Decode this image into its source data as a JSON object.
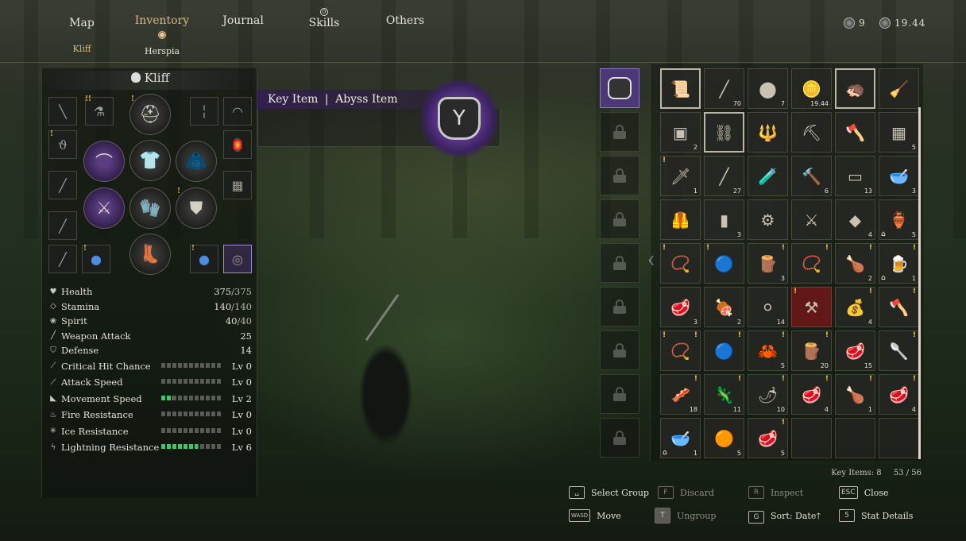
{
  "nav": {
    "tabs": [
      "Map",
      "Inventory",
      "Journal",
      "Skills",
      "Others"
    ],
    "skills_badge": "0",
    "subtabs": [
      "Kliff",
      "Herspia"
    ]
  },
  "currency": {
    "medals": "9",
    "coins": "19.44"
  },
  "character": {
    "name": "Kliff",
    "stats": [
      {
        "icon": "heart-icon",
        "label": "Health",
        "value": "375",
        "max": "/375"
      },
      {
        "icon": "stamina-icon",
        "label": "Stamina",
        "value": "140",
        "max": "/140"
      },
      {
        "icon": "spirit-icon",
        "label": "Spirit",
        "value": "40",
        "max": "/40"
      },
      {
        "icon": "sword-icon",
        "label": "Weapon Attack",
        "value": "25",
        "max": ""
      },
      {
        "icon": "shield-icon",
        "label": "Defense",
        "value": "14",
        "max": ""
      }
    ],
    "levels": [
      {
        "icon": "crit-icon",
        "label": "Critical Hit Chance",
        "level": "Lv 0",
        "fill": 0
      },
      {
        "icon": "attack-speed-icon",
        "label": "Attack Speed",
        "level": "Lv 0",
        "fill": 0
      },
      {
        "icon": "boot-icon",
        "label": "Movement Speed",
        "level": "Lv 2",
        "fill": 0.2
      },
      {
        "icon": "fire-icon",
        "label": "Fire Resistance",
        "level": "Lv 0",
        "fill": 0
      },
      {
        "icon": "snowflake-icon",
        "label": "Ice Resistance",
        "level": "Lv 0",
        "fill": 0
      },
      {
        "icon": "lightning-icon",
        "label": "Lightning Resistance",
        "level": "Lv 6",
        "fill": 0.6
      }
    ]
  },
  "detail": {
    "category": "Key Item",
    "separator": "|",
    "subtype": "Abyss Item"
  },
  "inventory": {
    "cells": [
      {
        "icon": "📜",
        "count": "",
        "sel": true
      },
      {
        "icon": "╱",
        "count": "70"
      },
      {
        "icon": "⬤",
        "count": "7"
      },
      {
        "icon": "🪙",
        "count": "19.44"
      },
      {
        "icon": "🦔",
        "count": "",
        "sel": true
      },
      {
        "icon": "🧹",
        "count": ""
      },
      {
        "icon": "▣",
        "count": "2"
      },
      {
        "icon": "⛓",
        "count": "",
        "sel": true
      },
      {
        "icon": "🔱",
        "count": ""
      },
      {
        "icon": "⛏",
        "count": ""
      },
      {
        "icon": "🪓",
        "count": ""
      },
      {
        "icon": "▦",
        "count": "5"
      },
      {
        "icon": "🗡",
        "count": "1",
        "exl": true
      },
      {
        "icon": "╱",
        "count": "27"
      },
      {
        "icon": "🧪",
        "count": ""
      },
      {
        "icon": "🔨",
        "count": "6"
      },
      {
        "icon": "▭",
        "count": "13"
      },
      {
        "icon": "🥣",
        "count": "3"
      },
      {
        "icon": "🦺",
        "count": ""
      },
      {
        "icon": "▮",
        "count": "3"
      },
      {
        "icon": "⚙",
        "count": ""
      },
      {
        "icon": "⚔",
        "count": ""
      },
      {
        "icon": "◆",
        "count": "4"
      },
      {
        "icon": "🏺",
        "count": "5",
        "house": true
      },
      {
        "icon": "📿",
        "count": "",
        "exl": true
      },
      {
        "icon": "🔵",
        "count": "",
        "exl": true
      },
      {
        "icon": "🪵",
        "count": "3",
        "ex": true
      },
      {
        "icon": "📿",
        "count": "",
        "ex": true
      },
      {
        "icon": "🍗",
        "count": "2",
        "ex": true
      },
      {
        "icon": "🍺",
        "count": "1",
        "ex": true,
        "house": true
      },
      {
        "icon": "🥩",
        "count": "3"
      },
      {
        "icon": "🍖",
        "count": "2"
      },
      {
        "icon": "⚪",
        "count": "14"
      },
      {
        "icon": "⚒",
        "count": "",
        "red": true,
        "exl": true
      },
      {
        "icon": "💰",
        "count": "4",
        "ex": true
      },
      {
        "icon": "🪓",
        "count": "",
        "ex": true
      },
      {
        "icon": "📿",
        "count": "",
        "exl": true,
        "ex": true
      },
      {
        "icon": "🔵",
        "count": "",
        "ex": true
      },
      {
        "icon": "🦀",
        "count": "5",
        "ex": true
      },
      {
        "icon": "🪵",
        "count": "20",
        "ex": true
      },
      {
        "icon": "🥩",
        "count": "15"
      },
      {
        "icon": "🥄",
        "count": "",
        "ex": true
      },
      {
        "icon": "🥓",
        "count": "18",
        "ex": true
      },
      {
        "icon": "🦎",
        "count": "11",
        "ex": true
      },
      {
        "icon": "🌶",
        "count": "10",
        "ex": true
      },
      {
        "icon": "🥩",
        "count": "4",
        "ex": true
      },
      {
        "icon": "🍗",
        "count": "1",
        "ex": true
      },
      {
        "icon": "🥩",
        "count": "4",
        "ex": true
      },
      {
        "icon": "🥣",
        "count": "1",
        "house": true
      },
      {
        "icon": "🟠",
        "count": "5"
      },
      {
        "icon": "🥩",
        "count": "5",
        "ex": true
      },
      {
        "icon": "",
        "count": "",
        "empty": true
      },
      {
        "icon": "",
        "count": "",
        "empty": true
      },
      {
        "icon": "",
        "count": "",
        "empty": true
      }
    ],
    "key_items": "Key Items: 8",
    "capacity": "53 / 56"
  },
  "controls": [
    {
      "key": "␣",
      "label": "Select Group",
      "dim": false,
      "fill": false
    },
    {
      "key": "F",
      "label": "Discard",
      "dim": true,
      "fill": false
    },
    {
      "key": "R",
      "label": "Inspect",
      "dim": true,
      "fill": false
    },
    {
      "key": "ESC",
      "label": "Close",
      "dim": false,
      "fill": false
    },
    {
      "key": "WASD",
      "label": "Move",
      "dim": false,
      "fill": false
    },
    {
      "key": "T",
      "label": "Ungroup",
      "dim": true,
      "fill": true
    },
    {
      "key": "G",
      "label": "Sort: Date🡑",
      "dim": false,
      "fill": false
    },
    {
      "key": "5",
      "label": "Stat Details",
      "dim": false,
      "fill": false
    }
  ]
}
